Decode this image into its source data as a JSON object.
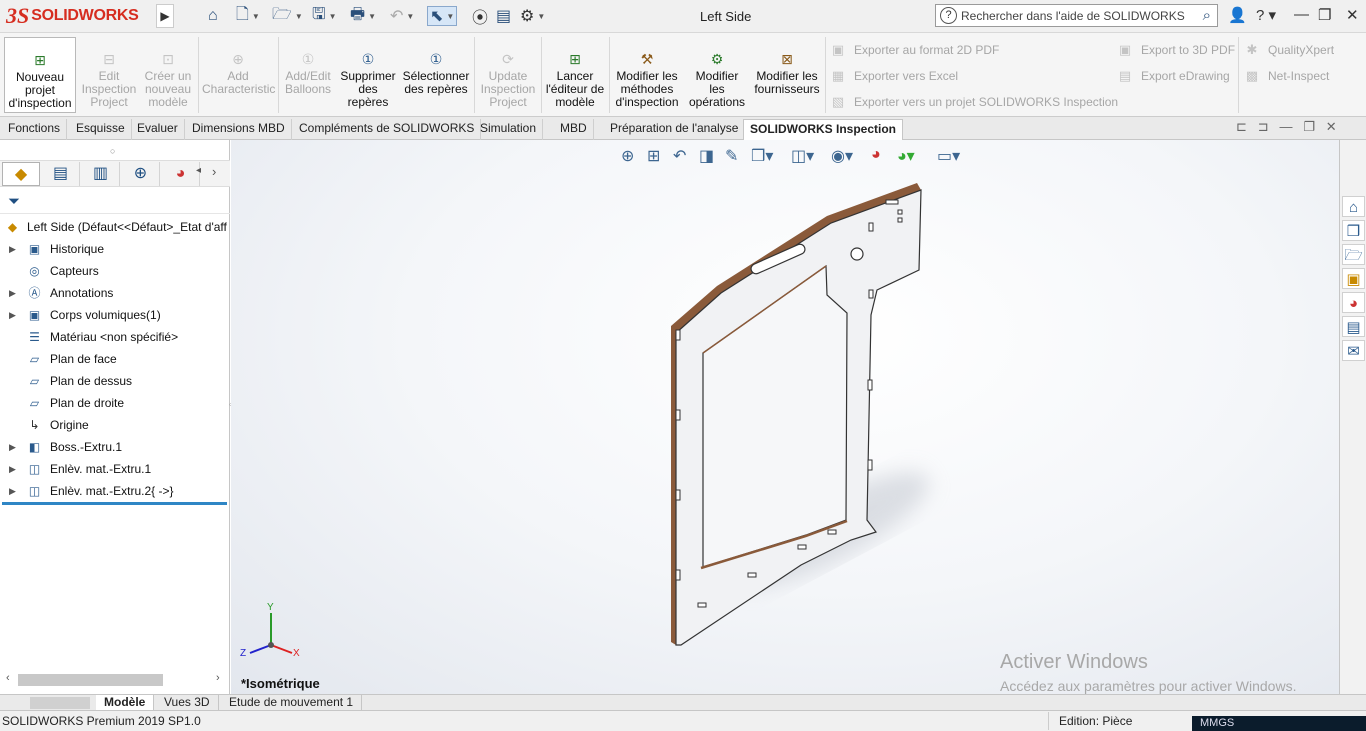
{
  "app": {
    "brand_ds": "3S",
    "brand_name": "SOLIDWORKS",
    "document_title": "Left Side",
    "search_placeholder": "Rechercher dans l'aide de SOLIDWORKS",
    "brand_color": "#d62d20",
    "accent_color": "#2f86c5"
  },
  "ribbon": {
    "buttons": [
      {
        "label": "Nouveau projet d'inspection",
        "icon": "new-inspection-project-icon",
        "enabled": true
      },
      {
        "label": "Edit Inspection Project",
        "icon": "edit-project-icon",
        "enabled": false
      },
      {
        "label": "Créer un nouveau modèle",
        "icon": "new-template-icon",
        "enabled": false
      },
      {
        "label": "Add Characteristic",
        "icon": "add-characteristic-icon",
        "enabled": false
      },
      {
        "label": "Add/Edit Balloons",
        "icon": "balloons-icon",
        "enabled": false
      },
      {
        "label": "Supprimer des repères",
        "icon": "delete-balloons-icon",
        "enabled": true
      },
      {
        "label": "Sélectionner des repères",
        "icon": "select-balloons-icon",
        "enabled": true
      },
      {
        "label": "Update Inspection Project",
        "icon": "update-project-icon",
        "enabled": false
      },
      {
        "label": "Lancer l'éditeur de modèle",
        "icon": "template-editor-icon",
        "enabled": true
      },
      {
        "label": "Modifier les méthodes d'inspection",
        "icon": "inspection-methods-icon",
        "enabled": true
      },
      {
        "label": "Modifier les opérations",
        "icon": "operations-icon",
        "enabled": true
      },
      {
        "label": "Modifier les fournisseurs",
        "icon": "vendors-icon",
        "enabled": true
      }
    ],
    "export_2d_pdf": "Exporter au format 2D PDF",
    "export_excel": "Exporter vers Excel",
    "export_sw_inspection": "Exporter vers un projet SOLIDWORKS Inspection",
    "export_3d_pdf": "Export to 3D PDF",
    "export_edrawing": "Export eDrawing",
    "quality_xpert": "QualityXpert",
    "net_inspect": "Net-Inspect"
  },
  "command_tabs": [
    {
      "label": "Fonctions"
    },
    {
      "label": "Esquisse"
    },
    {
      "label": "Evaluer"
    },
    {
      "label": "Dimensions MBD"
    },
    {
      "label": "Compléments de SOLIDWORKS"
    },
    {
      "label": "Simulation"
    },
    {
      "label": "MBD"
    },
    {
      "label": "Préparation de l'analyse"
    },
    {
      "label": "SOLIDWORKS Inspection",
      "active": true
    }
  ],
  "feature_tree": {
    "root": "Left Side  (Défaut<<Défaut>_Etat d'aff",
    "items": [
      {
        "label": "Historique",
        "icon": "history-icon",
        "expandable": true
      },
      {
        "label": "Capteurs",
        "icon": "sensor-icon",
        "expandable": false
      },
      {
        "label": "Annotations",
        "icon": "annotations-icon",
        "expandable": true
      },
      {
        "label": "Corps volumiques(1)",
        "icon": "solid-bodies-icon",
        "expandable": true
      },
      {
        "label": "Matériau <non spécifié>",
        "icon": "material-icon",
        "expandable": false
      },
      {
        "label": "Plan de face",
        "icon": "plane-icon",
        "expandable": false
      },
      {
        "label": "Plan de dessus",
        "icon": "plane-icon",
        "expandable": false
      },
      {
        "label": "Plan de droite",
        "icon": "plane-icon",
        "expandable": false
      },
      {
        "label": "Origine",
        "icon": "origin-icon",
        "expandable": false
      },
      {
        "label": "Boss.-Extru.1",
        "icon": "extrude-boss-icon",
        "expandable": true
      },
      {
        "label": "Enlèv. mat.-Extru.1",
        "icon": "extrude-cut-icon",
        "expandable": true
      },
      {
        "label": "Enlèv. mat.-Extru.2{ ->}",
        "icon": "extrude-cut-icon",
        "expandable": true
      }
    ]
  },
  "viewport": {
    "orientation_label": "*Isométrique",
    "triad_x": "X",
    "triad_y": "Y",
    "triad_z": "Z",
    "watermark_title": "Activer Windows",
    "watermark_text": "Accédez aux paramètres pour activer Windows."
  },
  "bottom_tabs": [
    {
      "label": "Modèle",
      "active": true
    },
    {
      "label": "Vues 3D"
    },
    {
      "label": "Etude de mouvement 1"
    }
  ],
  "status": {
    "product": "SOLIDWORKS Premium 2019 SP1.0",
    "edit_mode": "Edition: Pièce",
    "units": "MMGS"
  }
}
